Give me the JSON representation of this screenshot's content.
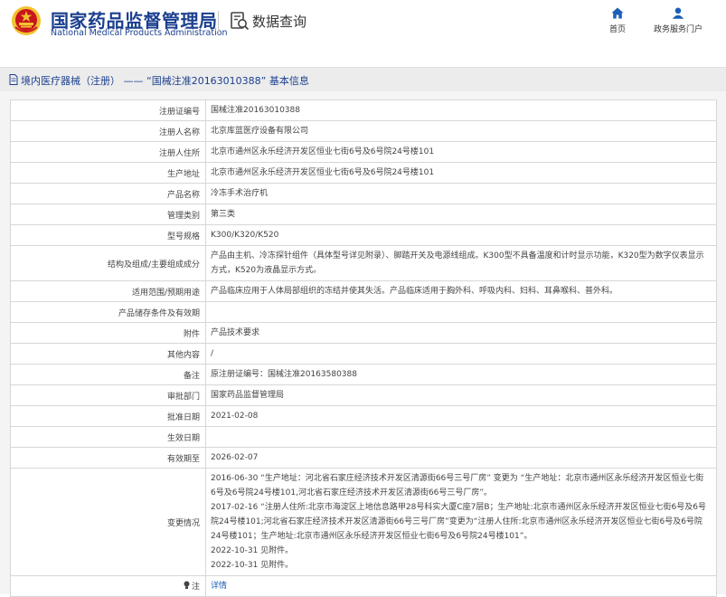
{
  "header": {
    "title_cn": "国家药品监督管理局",
    "title_en": "National Medical Products Administration",
    "query_label": "数据查询",
    "nav": [
      {
        "label": "首页",
        "icon": "home-icon"
      },
      {
        "label": "政务服务门户",
        "icon": "user-icon"
      }
    ],
    "colors": {
      "brand": "#1b3f8f",
      "emblem_red": "#c8161d",
      "emblem_gold": "#f2c230",
      "link": "#1b5fb5"
    }
  },
  "breadcrumb": {
    "text": "境内医疗器械（注册） —— “国械注准20163010388” 基本信息"
  },
  "table": {
    "rows": [
      {
        "label": "注册证编号",
        "value": "国械注准20163010388"
      },
      {
        "label": "注册人名称",
        "value": "北京库蓝医疗设备有限公司"
      },
      {
        "label": "注册人住所",
        "value": "北京市通州区永乐经济开发区恒业七街6号及6号院24号楼101"
      },
      {
        "label": "生产地址",
        "value": "北京市通州区永乐经济开发区恒业七街6号及6号院24号楼101"
      },
      {
        "label": "产品名称",
        "value": "冷冻手术治疗机"
      },
      {
        "label": "管理类别",
        "value": "第三类"
      },
      {
        "label": "型号规格",
        "value": "K300/K320/K520"
      },
      {
        "label": "结构及组成/主要组成成分",
        "value": "产品由主机、冷冻探针组件（具体型号详见附录）、脚踏开关及电源线组成。K300型不具备温度和计时显示功能，K320型为数字仪表显示方式，K520为液晶显示方式。"
      },
      {
        "label": "适用范围/预期用途",
        "value": "产品临床应用于人体局部组织的冻结并使其失活。产品临床适用于胸外科、呼吸内科、妇科、耳鼻喉科、普外科。"
      },
      {
        "label": "产品储存条件及有效期",
        "value": ""
      },
      {
        "label": "附件",
        "value": "产品技术要求"
      },
      {
        "label": "其他内容",
        "value": "/"
      },
      {
        "label": "备注",
        "value": "原注册证编号：国械注准20163580388"
      },
      {
        "label": "审批部门",
        "value": "国家药品监督管理局"
      },
      {
        "label": "批准日期",
        "value": "2021-02-08"
      },
      {
        "label": "生效日期",
        "value": ""
      },
      {
        "label": "有效期至",
        "value": "2026-02-07"
      }
    ],
    "change_label": "变更情况",
    "change_lines": [
      "2016-06-30 “生产地址：河北省石家庄经济技术开发区清源街66号三号厂房” 变更为 “生产地址：北京市通州区永乐经济开发区恒业七街6号及6号院24号楼101,河北省石家庄经济技术开发区清源街66号三号厂房”。",
      "2017-02-16 “注册人住所:北京市海淀区上地信息路甲28号科实大厦C座7层B；生产地址:北京市通州区永乐经济开发区恒业七街6号及6号院24号楼101;河北省石家庄经济技术开发区清源街66号三号厂房”变更为“注册人住所:北京市通州区永乐经济开发区恒业七街6号及6号院24号楼101；生产地址:北京市通州区永乐经济开发区恒业七街6号及6号院24号楼101”。",
      "2022-10-31 见附件。",
      "2022-10-31 见附件。"
    ],
    "note_label": "注",
    "note_icon": "lightbulb-icon",
    "note_link": "详情"
  }
}
